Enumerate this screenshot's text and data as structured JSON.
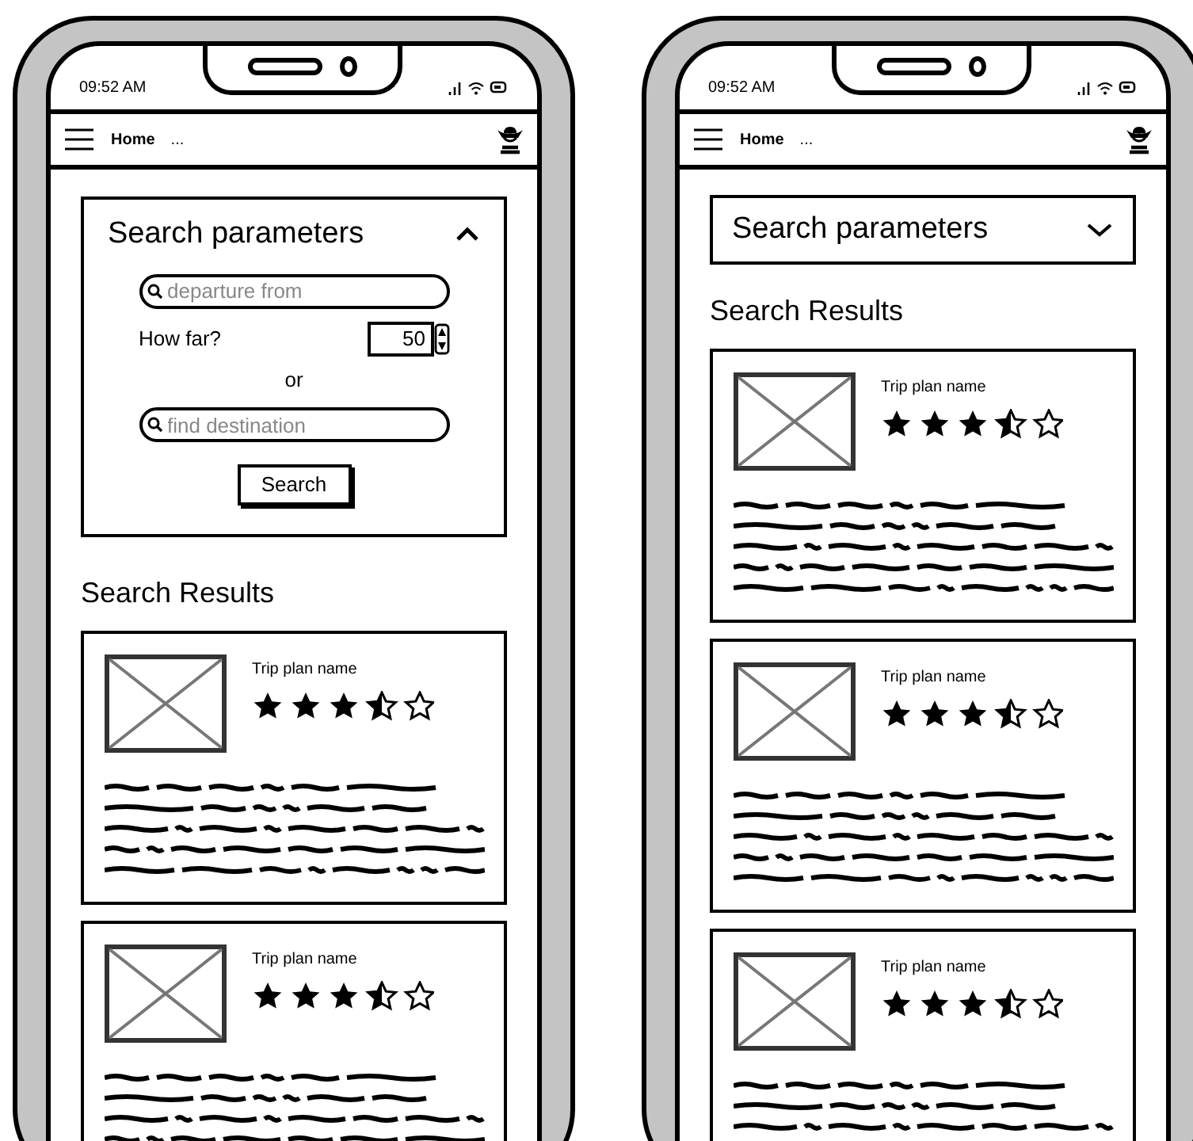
{
  "phones": [
    {
      "status_bar": {
        "time": "09:52 AM"
      },
      "nav": {
        "title": "Home",
        "extra": "..."
      },
      "search_panel": {
        "title": "Search parameters",
        "expanded": true,
        "departure": {
          "placeholder": "departure from"
        },
        "distance": {
          "label": "How far?",
          "value": "50"
        },
        "or_label": "or",
        "destination": {
          "placeholder": "find destination"
        },
        "search_button": "Search"
      },
      "results_title": "Search Results",
      "results": [
        {
          "name": "Trip plan name",
          "stars": 3.5
        },
        {
          "name": "Trip plan name",
          "stars": 3.5
        }
      ]
    },
    {
      "status_bar": {
        "time": "09:52 AM"
      },
      "nav": {
        "title": "Home",
        "extra": "..."
      },
      "search_panel": {
        "title": "Search parameters",
        "expanded": false
      },
      "results_title": "Search Results",
      "results": [
        {
          "name": "Trip plan name",
          "stars": 3.5
        },
        {
          "name": "Trip plan name",
          "stars": 3.5
        },
        {
          "name": "Trip plan name",
          "stars": 3.5
        }
      ]
    }
  ]
}
